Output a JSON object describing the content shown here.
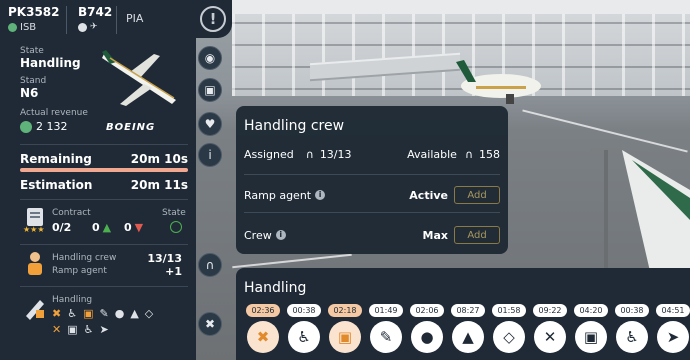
{
  "flight": {
    "code": "PK3582",
    "origin": "ISB",
    "aircraft_type": "B742",
    "airline": "PIA"
  },
  "aircraft": {
    "state_label": "State",
    "state": "Handling",
    "stand_label": "Stand",
    "stand": "N6",
    "revenue_label": "Actual revenue",
    "revenue": "2 132",
    "maker": "BOEING"
  },
  "timing": {
    "remaining_label": "Remaining",
    "remaining": "20m 10s",
    "estimation_label": "Estimation",
    "estimation": "20m 11s"
  },
  "contract": {
    "label": "Contract",
    "value": "0/2",
    "likes": "0",
    "dislikes": "0",
    "state_label": "State"
  },
  "crew_summary": {
    "label": "Handling crew",
    "value": "13/13",
    "sub_label": "Ramp agent",
    "sub_value": "+1"
  },
  "handling_summary": {
    "label": "Handling"
  },
  "popup": {
    "title": "Handling crew",
    "assigned_label": "Assigned",
    "assigned": "13/13",
    "available_label": "Available",
    "available": "158",
    "rows": [
      {
        "label": "Ramp agent",
        "status": "Active",
        "button": "Add"
      },
      {
        "label": "Crew",
        "status": "Max",
        "button": "Add"
      }
    ]
  },
  "handling": {
    "title": "Handling",
    "tasks": [
      {
        "time": "02:36",
        "icon": "baggage-off-icon",
        "active": true
      },
      {
        "time": "00:38",
        "icon": "accessibility-icon",
        "active": false
      },
      {
        "time": "02:18",
        "icon": "cargo-unload-icon",
        "active": true
      },
      {
        "time": "01:49",
        "icon": "refuel-hose-icon",
        "active": false
      },
      {
        "time": "02:06",
        "icon": "water-service-icon",
        "active": false
      },
      {
        "time": "08:27",
        "icon": "waste-service-icon",
        "active": false
      },
      {
        "time": "01:58",
        "icon": "fuel-icon",
        "active": false
      },
      {
        "time": "09:22",
        "icon": "catering-icon",
        "active": false
      },
      {
        "time": "04:20",
        "icon": "cargo-load-icon",
        "active": false
      },
      {
        "time": "00:38",
        "icon": "accessibility-icon",
        "active": false
      },
      {
        "time": "04:51",
        "icon": "boarding-icon",
        "active": false
      }
    ]
  },
  "colors": {
    "panel": "#1f2a36",
    "remaining_bar": "#f0a890",
    "estimation_bar": "#f7c7b8",
    "accent_active": "#f4c9a4",
    "green": "#4caf50",
    "red": "#e05a4f"
  }
}
